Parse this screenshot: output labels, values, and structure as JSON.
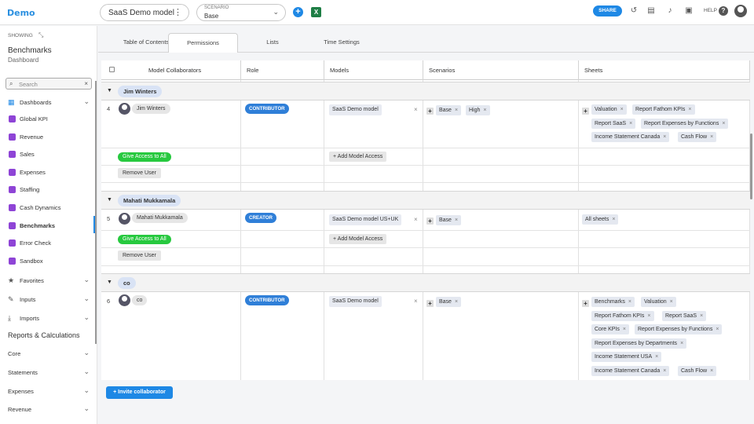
{
  "app": {
    "name": "Demo"
  },
  "topbar": {
    "model_name": "SaaS Demo model",
    "scenario_label": "SCENARIO",
    "scenario_value": "Base",
    "share_label": "SHARE",
    "help_label": "HELP"
  },
  "sidebar": {
    "showing_label": "SHOWING",
    "title": "Benchmarks",
    "subtitle": "Dashboard",
    "search_placeholder": "Search",
    "items": [
      {
        "label": "Dashboards"
      },
      {
        "label": "Global KPI"
      },
      {
        "label": "Revenue"
      },
      {
        "label": "Sales"
      },
      {
        "label": "Expenses"
      },
      {
        "label": "Staffing"
      },
      {
        "label": "Cash Dynamics"
      },
      {
        "label": "Benchmarks"
      },
      {
        "label": "Error Check"
      },
      {
        "label": "Sandbox"
      },
      {
        "label": "Favorites"
      },
      {
        "label": "Inputs"
      },
      {
        "label": "Imports"
      },
      {
        "label": "Reports & Calculations"
      },
      {
        "label": "Core"
      },
      {
        "label": "Statements"
      },
      {
        "label": "Expenses"
      },
      {
        "label": "Revenue"
      }
    ]
  },
  "tabs": [
    {
      "label": "Table of Contents"
    },
    {
      "label": "Permissions"
    },
    {
      "label": "Lists"
    },
    {
      "label": "Time Settings"
    }
  ],
  "table": {
    "headers": [
      "Model Collaborators",
      "Role",
      "Models",
      "Scenarios",
      "Sheets"
    ],
    "give_access_label": "Give Access to All",
    "remove_user_label": "Remove User",
    "add_model_label": "+ Add Model Access",
    "groups": [
      {
        "name": "Jim Winters",
        "row": "4",
        "user": "Jim Winters",
        "role": "CONTRIBUTOR",
        "model": "SaaS Demo model",
        "scenarios": [
          "Base",
          "High"
        ],
        "sheets": [
          "Valuation",
          "Report Fathom KPIs",
          "Report SaaS",
          "Report Expenses by Functions",
          "Income Statement Canada",
          "Cash Flow"
        ]
      },
      {
        "name": "Mahati Mukkamala",
        "row": "5",
        "user": "Mahati Mukkamala",
        "role": "CREATOR",
        "model": "SaaS Demo model US+UK",
        "scenarios": [
          "Base"
        ],
        "sheets": [
          "All sheets"
        ]
      },
      {
        "name": "co",
        "row": "6",
        "user": "co",
        "role": "CONTRIBUTOR",
        "model": "SaaS Demo model",
        "scenarios": [
          "Base"
        ],
        "sheets": [
          "Benchmarks",
          "Valuation",
          "Report Fathom KPIs",
          "Report SaaS",
          "Core KPIs",
          "Report Expenses by Functions",
          "Report Expenses by Departments",
          "Income Statement USA",
          "Income Statement Canada",
          "Cash Flow"
        ]
      }
    ]
  },
  "invite_label": "+ Invite collaborator"
}
